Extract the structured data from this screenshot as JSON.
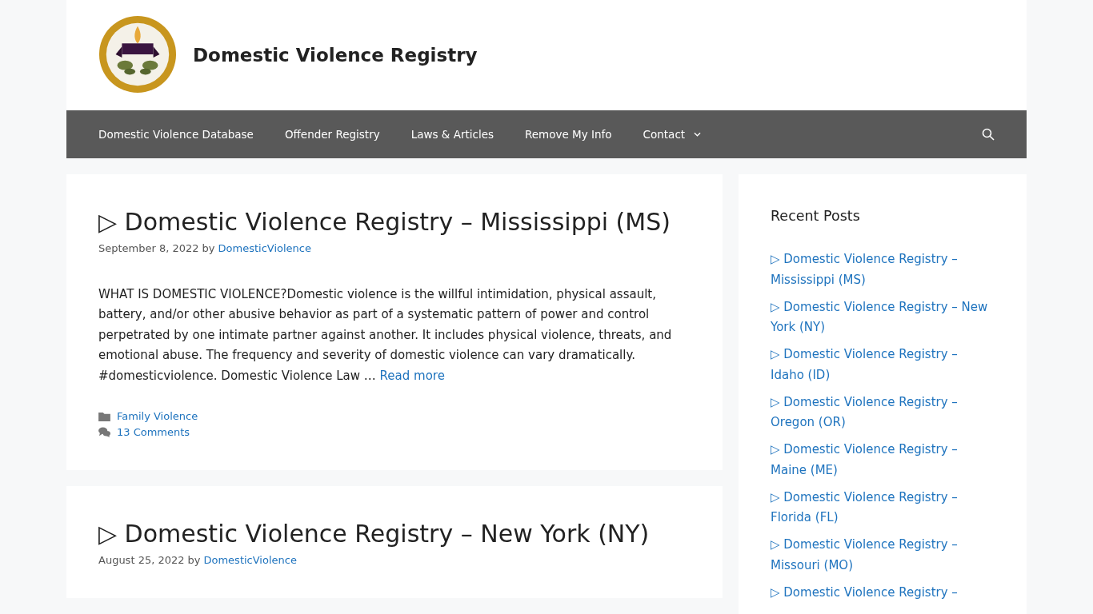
{
  "site": {
    "title": "Domestic Violence Registry"
  },
  "nav": {
    "items": [
      {
        "label": "Domestic Violence Database",
        "has_submenu": false
      },
      {
        "label": "Offender Registry",
        "has_submenu": false
      },
      {
        "label": "Laws & Articles",
        "has_submenu": false
      },
      {
        "label": "Remove My Info",
        "has_submenu": false
      },
      {
        "label": "Contact",
        "has_submenu": true
      }
    ]
  },
  "posts": [
    {
      "title": "▷ Domestic Violence Registry – Mississippi (MS)",
      "date": "September 8, 2022",
      "by": "by",
      "author": "DomesticViolence",
      "excerpt": "WHAT IS DOMESTIC VIOLENCE?Domestic violence is the willful intimidation, physical assault, battery,  and/or other abusive behavior as part of a systematic pattern of power and control perpetrated by one intimate partner against another. It includes physical violence, threats, and emotional abuse. The frequency and severity of domestic violence can vary dramatically. #domesticviolence. Domestic Violence Law …",
      "read_more": "Read more",
      "category": "Family Violence",
      "comments": "13 Comments"
    },
    {
      "title": "▷ Domestic Violence Registry – New York (NY)",
      "date": "August 25, 2022",
      "by": "by",
      "author": "DomesticViolence"
    }
  ],
  "sidebar": {
    "heading": "Recent Posts",
    "links": [
      "▷ Domestic Violence Registry – Mississippi (MS)",
      "▷ Domestic Violence Registry – New York (NY)",
      "▷ Domestic Violence Registry – Idaho (ID)",
      "▷ Domestic Violence Registry – Oregon (OR)",
      "▷ Domestic Violence Registry – Maine (ME)",
      "▷ Domestic Violence Registry – Florida (FL)",
      "▷ Domestic Violence Registry – Missouri (MO)",
      "▷ Domestic Violence Registry –"
    ]
  }
}
